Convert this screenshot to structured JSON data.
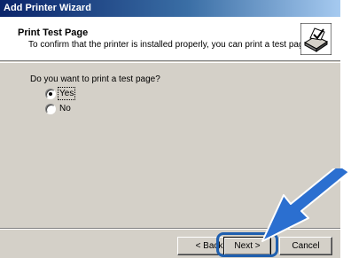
{
  "window": {
    "title": "Add Printer Wizard"
  },
  "header": {
    "title": "Print Test Page",
    "subtitle": "To confirm that the printer is installed properly, you can print a test page.",
    "icon": "printer-check-icon"
  },
  "body": {
    "question": "Do you want to print a test page?",
    "options": [
      {
        "label": "Yes",
        "selected": true
      },
      {
        "label": "No",
        "selected": false
      }
    ]
  },
  "buttons": {
    "back": "< Back",
    "next": "Next >",
    "cancel": "Cancel"
  },
  "colors": {
    "titlebar_start": "#0a246a",
    "titlebar_end": "#a6caf0",
    "dialog_face": "#d4d0c8",
    "highlight_ring": "#1f5fae",
    "arrow": "#2b6fd0"
  },
  "annotation": {
    "arrow_icon": "pointer-arrow-icon",
    "target": "next-button"
  }
}
